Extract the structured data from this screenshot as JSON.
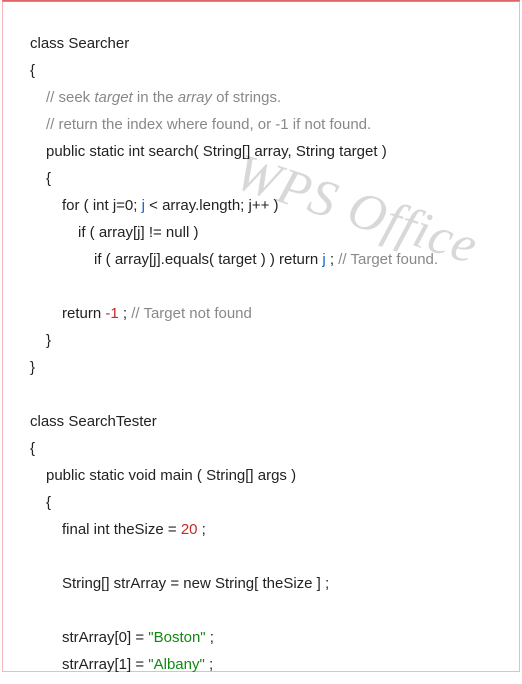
{
  "watermark": "WPS Office",
  "code": {
    "l1": "class Searcher",
    "l2": "{",
    "l3a": "// seek ",
    "l3b": "target",
    "l3c": " in the ",
    "l3d": "array",
    "l3e": " of strings.",
    "l4": "// return the index where found, or -1 if not found.",
    "l5": "public static int search( String[] array, String target )",
    "l6": "{",
    "l7a": "for ( int j=0; ",
    "l7b": "j",
    "l7c": " < array.length; j++ )",
    "l8": "if ( array[j] != null )",
    "l9a": "if ( array[j].equals( target ) ) return ",
    "l9b": "j",
    "l9c": " ; ",
    "l9d": "// Target found.",
    "l10a": "return ",
    "l10b": "-1",
    "l10c": " ; ",
    "l10d": "// Target not found",
    "l11": "}",
    "l12": "}",
    "l13": "class SearchTester",
    "l14": "{",
    "l15": "public static void main ( String[] args )",
    "l16": "{",
    "l17a": "final int theSize = ",
    "l17b": "20",
    "l17c": " ;",
    "l18": "String[] strArray = new String[ theSize ] ;",
    "l19a": "strArray[0] = ",
    "l19b": "\"Boston\"",
    "l19c": " ;",
    "l20a": "strArray[1] = ",
    "l20b": "\"Albany\"",
    "l20c": " ;"
  }
}
